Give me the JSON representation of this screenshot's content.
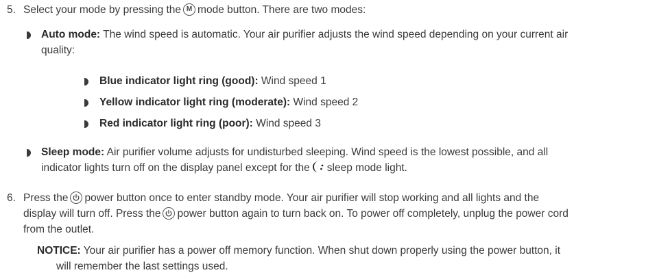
{
  "step5": {
    "number": "5.",
    "text_before": "Select your mode by pressing the",
    "button_symbol": "M",
    "text_after": "mode button. There are two modes:"
  },
  "auto_mode": {
    "label": "Auto mode:",
    "text_line1": "The wind speed is automatic. Your air purifier adjusts the wind speed depending on your current air",
    "text_line2": "quality:",
    "levels": [
      {
        "label": "Blue indicator light ring (good):",
        "text": "Wind speed 1"
      },
      {
        "label": "Yellow indicator light ring (moderate):",
        "text": "Wind speed 2"
      },
      {
        "label": "Red indicator light ring (poor):",
        "text": "Wind speed 3"
      }
    ]
  },
  "sleep_mode": {
    "label": "Sleep mode:",
    "text_line1": "Air purifier volume adjusts for undisturbed sleeping. Wind speed is the lowest possible, and all",
    "text_line2_before": "indicator lights turn off on the display panel except for the",
    "text_line2_after": "sleep mode light."
  },
  "step6": {
    "number": "6.",
    "line1_before": "Press the",
    "line1_after": "power button once to enter standby mode. Your air purifier will stop working and all lights and the",
    "line2_before": "display will turn off. Press the",
    "line2_after": "power button again to turn back on. To power off completely, unplug the power cord",
    "line3": "from the outlet."
  },
  "notice": {
    "label": "NOTICE:",
    "line1": "Your air purifier has a power off memory function. When shut down properly using the power button, it",
    "line2": "will remember the last settings used."
  },
  "icons": {
    "mode_button": "mode-button-icon",
    "power_button": "power-button-icon",
    "sleep_light": "moon-icon",
    "bullet": "bullet-icon"
  }
}
